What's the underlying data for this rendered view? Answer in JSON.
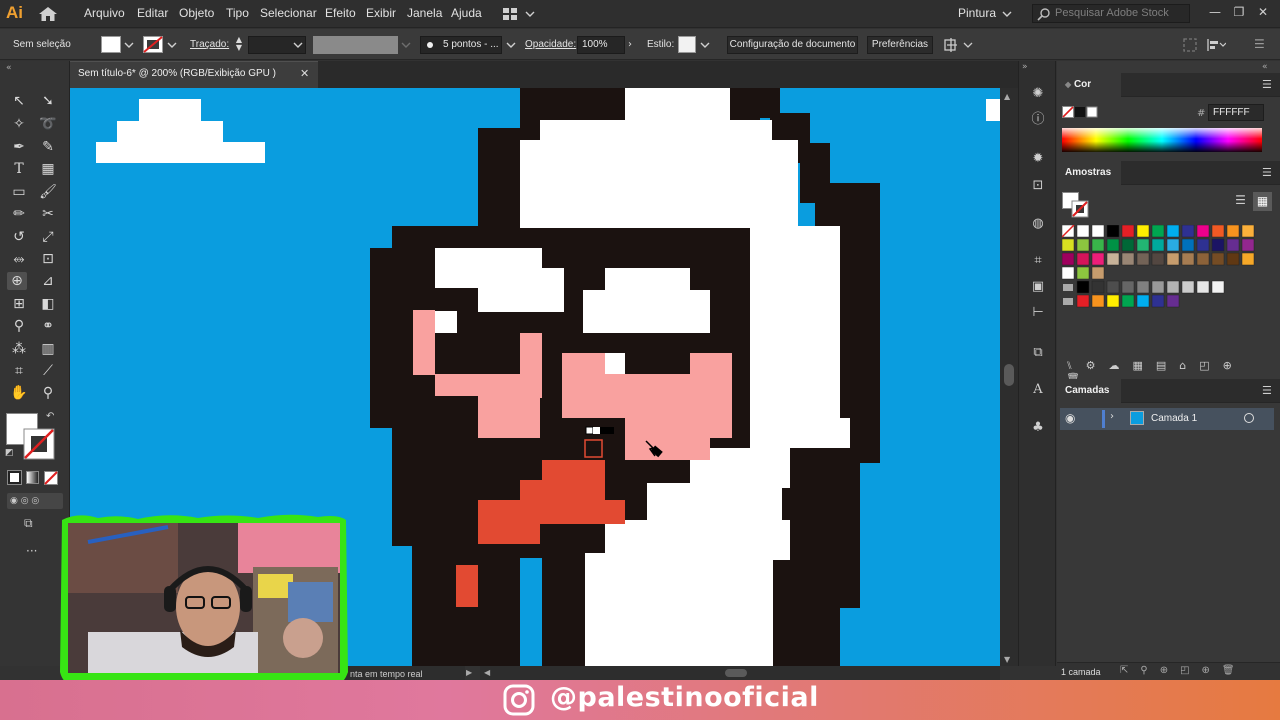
{
  "app": {
    "logo": "Ai",
    "workspace": "Pintura",
    "stock_placeholder": "Pesquisar Adobe Stock"
  },
  "menu": [
    "Arquivo",
    "Editar",
    "Objeto",
    "Tipo",
    "Selecionar",
    "Efeito",
    "Exibir",
    "Janela",
    "Ajuda"
  ],
  "control": {
    "selection": "Sem seleção",
    "stroke_label": "Traçado:",
    "brush": "5 pontos - ...",
    "opacity_label": "Opacidade:",
    "opacity_value": "100%",
    "style_label": "Estilo:",
    "doc_setup": "Configuração de documento",
    "preferences": "Preferências"
  },
  "document": {
    "tab_title": "Sem título-6* @ 200% (RGB/Exibição GPU )",
    "status": "nta em tempo real"
  },
  "panels": {
    "color": {
      "title": "Cor",
      "hex_label": "#",
      "hex_value": "FFFFFF"
    },
    "swatches": {
      "title": "Amostras"
    },
    "layers": {
      "title": "Camadas",
      "layer_name": "Camada 1",
      "count": "1 camada"
    }
  },
  "banner": {
    "handle": "@palestinooficial"
  },
  "colors": {
    "canvas_bg": "#0a9ddf",
    "dark": "#1b1210",
    "pink": "#f9a19f",
    "red": "#e24a32",
    "white": "#ffffff",
    "accent": "#f0a030"
  }
}
